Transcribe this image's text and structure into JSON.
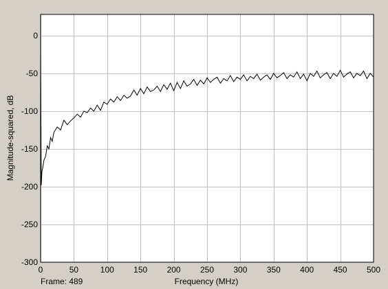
{
  "colors": {
    "background": "#d4d0c8",
    "plot_background": "#ffffff",
    "grid": "#c0c0c0",
    "trace": "#000000",
    "axes": "#000000"
  },
  "frame_text": "Frame: 489",
  "chart_data": {
    "type": "line",
    "xlabel": "Frequency (MHz)",
    "ylabel": "Magnitude-squared, dB",
    "xlim": [
      0,
      500
    ],
    "ylim": [
      -300,
      28
    ],
    "xticks": [
      0,
      50,
      100,
      150,
      200,
      250,
      300,
      350,
      400,
      450,
      500
    ],
    "yticks": [
      -300,
      -250,
      -200,
      -150,
      -100,
      -50,
      0
    ],
    "grid": true,
    "series": [
      {
        "x": [
          0,
          1,
          2,
          3,
          4,
          5,
          7.5,
          10,
          12.5,
          15,
          17.5,
          20,
          25,
          30,
          35,
          40,
          45,
          50,
          55,
          60,
          65,
          70,
          75,
          80,
          85,
          90,
          95,
          100,
          105,
          110,
          115,
          120,
          125,
          130,
          135,
          140,
          145,
          150,
          155,
          160,
          165,
          170,
          175,
          180,
          185,
          190,
          195,
          200,
          205,
          210,
          215,
          220,
          225,
          230,
          235,
          240,
          245,
          250,
          255,
          260,
          265,
          270,
          275,
          280,
          285,
          290,
          295,
          300,
          305,
          310,
          315,
          320,
          325,
          330,
          335,
          340,
          345,
          350,
          355,
          360,
          365,
          370,
          375,
          380,
          385,
          390,
          395,
          400,
          405,
          410,
          415,
          420,
          425,
          430,
          435,
          440,
          445,
          450,
          455,
          460,
          465,
          470,
          475,
          480,
          485,
          490,
          495,
          500
        ],
        "y": [
          -18,
          -198,
          -180,
          -176,
          -171,
          -165,
          -160,
          -146,
          -150,
          -135,
          -140,
          -128,
          -121,
          -125,
          -112,
          -118,
          -113,
          -109,
          -104,
          -108,
          -100,
          -102,
          -96,
          -100,
          -92,
          -99,
          -88,
          -91,
          -84,
          -88,
          -81,
          -86,
          -79,
          -83,
          -80,
          -72,
          -79,
          -70,
          -77,
          -68,
          -74,
          -72,
          -67,
          -74,
          -65,
          -71,
          -63,
          -73,
          -62,
          -70,
          -60,
          -67,
          -64,
          -58,
          -66,
          -59,
          -64,
          -56,
          -62,
          -58,
          -55,
          -63,
          -57,
          -60,
          -53,
          -61,
          -55,
          -58,
          -52,
          -60,
          -54,
          -57,
          -51,
          -59,
          -55,
          -52,
          -58,
          -50,
          -56,
          -53,
          -49,
          -57,
          -52,
          -55,
          -48,
          -57,
          -51,
          -60,
          -50,
          -54,
          -47,
          -56,
          -52,
          -49,
          -57,
          -50,
          -54,
          -46,
          -55,
          -51,
          -48,
          -56,
          -50,
          -53,
          -47,
          -57,
          -50,
          -55
        ]
      }
    ]
  }
}
